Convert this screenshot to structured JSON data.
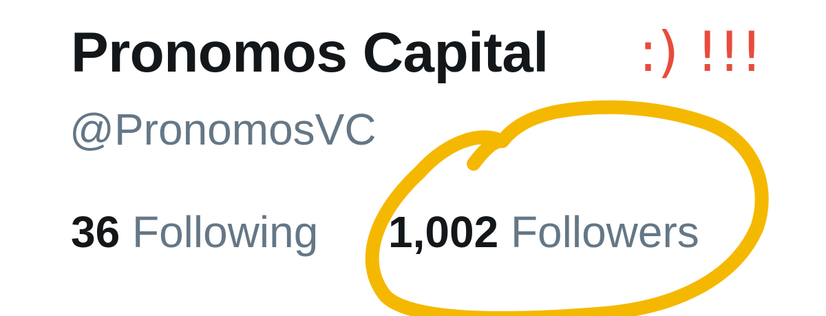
{
  "profile": {
    "display_name": "Pronomos Capital",
    "handle": "@PronomosVC"
  },
  "stats": {
    "following_count": "36",
    "following_label": "Following",
    "followers_count": "1,002",
    "followers_label": "Followers"
  },
  "annotations": {
    "smiley_text": ":) !!!",
    "smiley_color": "#e74c3c",
    "circle_color": "#f5b800"
  },
  "colors": {
    "primary_text": "#14171a",
    "secondary_text": "#657786"
  }
}
